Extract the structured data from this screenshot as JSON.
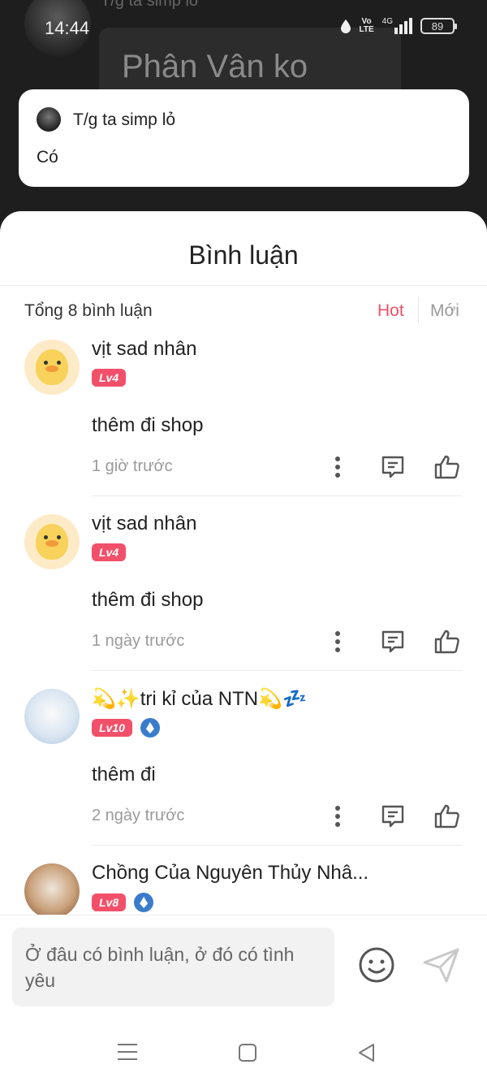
{
  "status_bar": {
    "time": "14:44",
    "volte": "Vo\nLTE",
    "network": "4G",
    "battery": "89"
  },
  "background_chat": {
    "sender_name": "T/g ta simp lỏ",
    "message": "Phân Vân ko"
  },
  "notification": {
    "title": "T/g ta simp lỏ",
    "body": "Có"
  },
  "comments_sheet": {
    "title": "Bình luận",
    "total": "Tổng 8 bình luận",
    "sort_hot": "Hot",
    "sort_new": "Mới",
    "accent_color": "#f2506a",
    "items": [
      {
        "name": "vịt sad nhân",
        "level": "Lv4",
        "text": "thêm đi shop",
        "time": "1 giờ trước",
        "avatar": "duck-avatar"
      },
      {
        "name": "vịt sad nhân",
        "level": "Lv4",
        "text": "thêm đi shop",
        "time": "1 ngày trước",
        "avatar": "duck-avatar"
      },
      {
        "name": "💫✨tri kỉ của NTN💫💤",
        "level": "Lv10",
        "text": "thêm đi",
        "time": "2 ngày trước",
        "avatar": "anime-avatar"
      },
      {
        "name": "Chồng Của Nguyên Thủy Nhâ...",
        "level": "Lv8",
        "text": "",
        "time": "",
        "avatar": "anime-avatar"
      }
    ]
  },
  "input": {
    "placeholder": "Ở đâu có bình luận, ở đó có tình yêu"
  }
}
